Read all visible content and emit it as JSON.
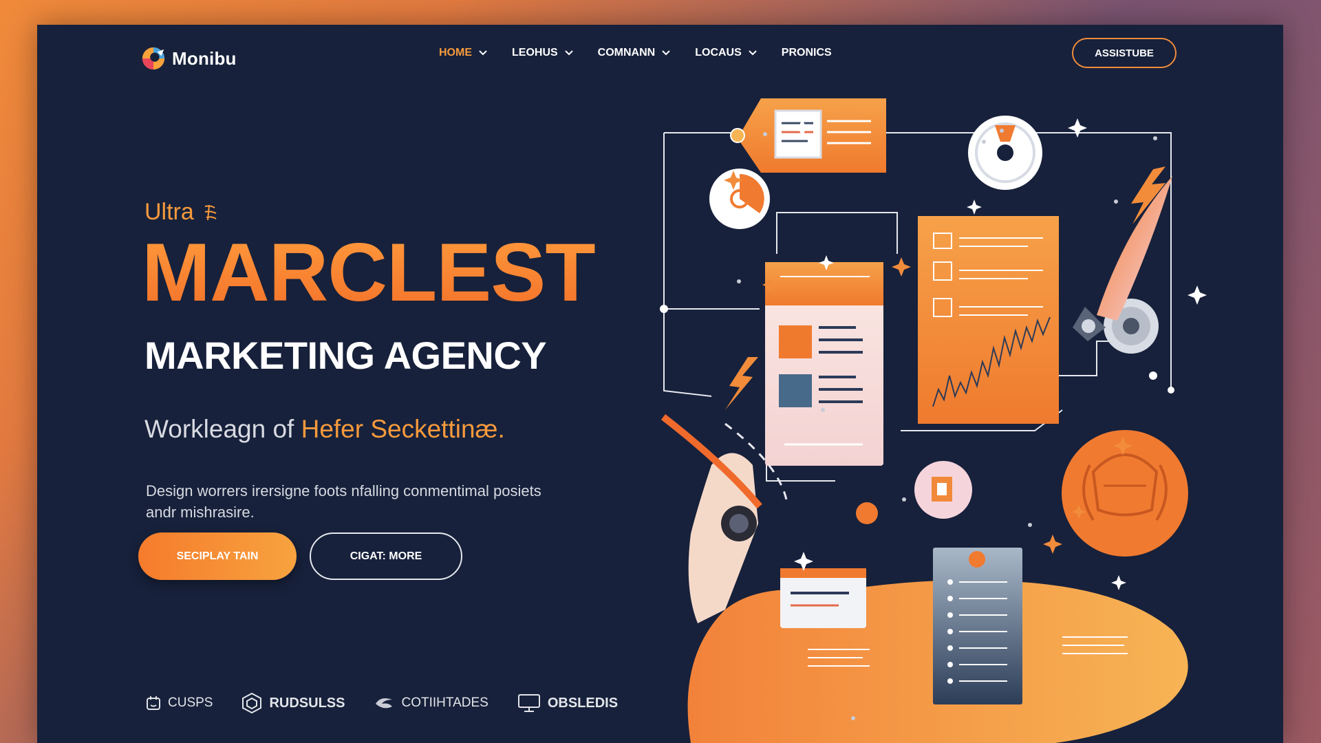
{
  "brand": {
    "name": "Monibu"
  },
  "nav": {
    "items": [
      {
        "label": "HOME",
        "active": true,
        "dropdown": true
      },
      {
        "label": "LEOHUS",
        "active": false,
        "dropdown": true
      },
      {
        "label": "COMNANN",
        "active": false,
        "dropdown": true
      },
      {
        "label": "LOCAUS",
        "active": false,
        "dropdown": true
      },
      {
        "label": "PRONICS",
        "active": false,
        "dropdown": false
      }
    ],
    "cta_label": "ASSISTUBE"
  },
  "hero": {
    "eyebrow": "Ultra",
    "title": "MARCLEST",
    "subtitle": "MARKETING AGENCY",
    "tagline_plain": "Workleagn of ",
    "tagline_highlight": "Hefer Seckettinæ.",
    "description": "Design worrers irersigne foots nfalling conmentimal posiets andr mishrasire.",
    "primary_button": "SECIPLAY TAIN",
    "secondary_button": "CIGAT: MORE"
  },
  "clients": [
    {
      "name": "CUSPS",
      "icon": "calendar-icon"
    },
    {
      "name": "RUDSULSS",
      "icon": "hexagon-icon"
    },
    {
      "name": "COTIIHTADES",
      "icon": "swirl-icon"
    },
    {
      "name": "OBSLEDIS",
      "icon": "monitor-icon"
    }
  ],
  "colors": {
    "accent": "#f7882f",
    "background": "#17213b",
    "text": "#ffffff"
  }
}
